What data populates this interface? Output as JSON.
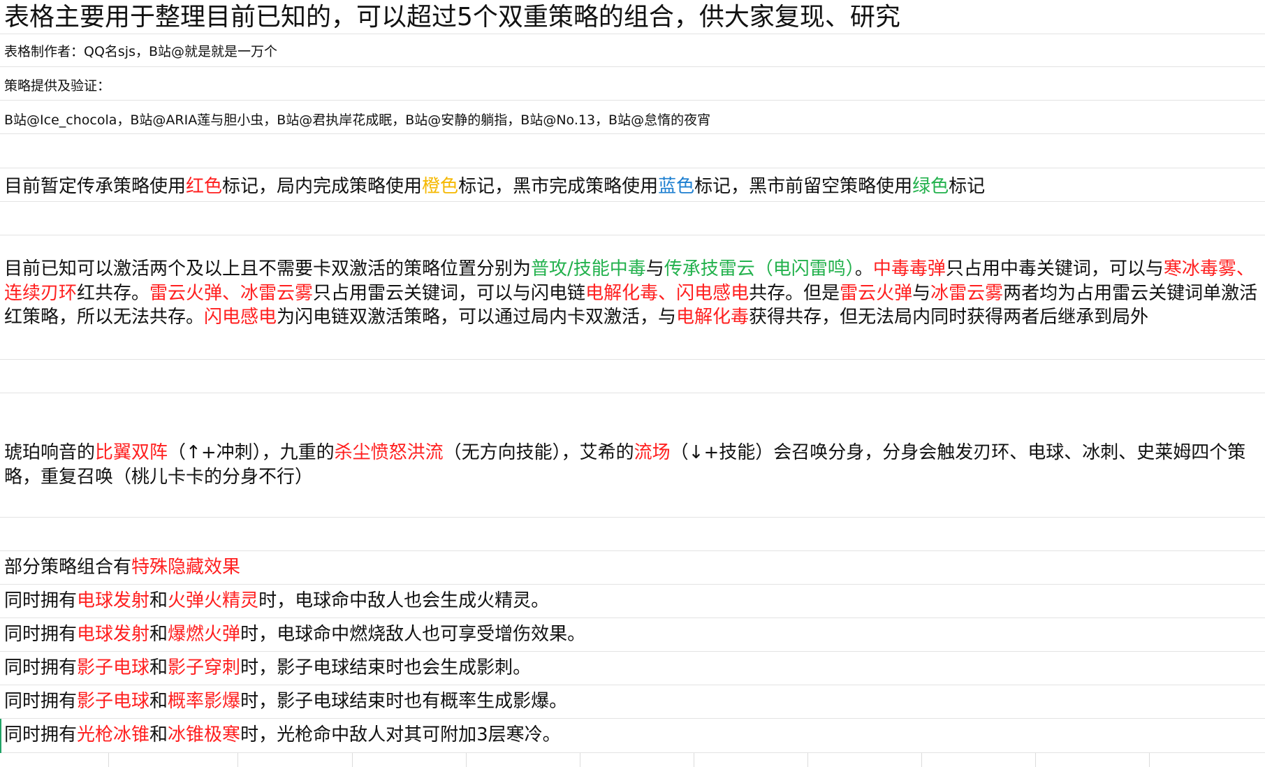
{
  "title": "表格主要用于整理目前已知的，可以超过5个双重策略的组合，供大家复现、研究",
  "author": "表格制作者：QQ名sjs，B站@就是就是一万个",
  "providers_label": "策略提供及验证：",
  "providers": "B站@Ice_chocola，B站@ARIA莲与胆小虫，B站@君执岸花成眠，B站@安静的躺指，B站@No.13，B站@怠惰的夜宵",
  "legend": {
    "p1": "目前暂定传承策略使用",
    "red": "红色",
    "p2": "标记，局内完成策略使用",
    "orange": "橙色",
    "p3": "标记，黑市完成策略使用",
    "blue": "蓝色",
    "p4": "标记，黑市前留空策略使用",
    "green": "绿色",
    "p5": "标记"
  },
  "para1": {
    "a": "目前已知可以激活两个及以上且不需要卡双激活的策略位置分别为",
    "b": "普攻/技能中毒",
    "c": "与",
    "d": "传承技雷云（电闪雷鸣）",
    "e": "。",
    "f": "中毒毒弹",
    "g": "只占用中毒关键词，可以与",
    "h": "寒冰毒雾、连续刃环",
    "i": "红共存。",
    "j": "雷云火弹、冰雷云雾",
    "k": "只占用雷云关键词，可以与闪电链",
    "l": "电解化毒、闪电感电",
    "m": "共存。但是",
    "n": "雷云火弹",
    "o": "与",
    "p": "冰雷云雾",
    "q": "两者均为占用雷云关键词单激活红策略，所以无法共存。",
    "r": "闪电感电",
    "s": "为闪电链双激活策略，可以通过局内卡双激活，与",
    "t": "电解化毒",
    "u": "获得共存，但无法局内同时获得两者后继承到局外"
  },
  "para2": {
    "a": "琥珀响音的",
    "b": "比翼双阵",
    "c": "（↑+冲刺），九重的",
    "d": "杀尘愤怒洪流",
    "e": "（无方向技能），艾希的",
    "f": "流场",
    "g": "（↓+技能）会召唤分身，分身会触发刃环、电球、冰刺、史莱姆四个策略，重复召唤（桃儿卡卡的分身不行）"
  },
  "hidden": {
    "a": "部分策略组合有",
    "b": "特殊隐藏效果"
  },
  "combos": [
    {
      "a": "同时拥有",
      "b": "电球发射",
      "c": "和",
      "d": "火弹火精灵",
      "e": "时，电球命中敌人也会生成火精灵。"
    },
    {
      "a": "同时拥有",
      "b": "电球发射",
      "c": "和",
      "d": "爆燃火弹",
      "e": "时，电球命中燃烧敌人也可享受增伤效果。"
    },
    {
      "a": "同时拥有",
      "b": "影子电球",
      "c": "和",
      "d": "影子穿刺",
      "e": "时，影子电球结束时也会生成影刺。"
    },
    {
      "a": "同时拥有",
      "b": "影子电球",
      "c": "和",
      "d": "概率影爆",
      "e": "时，影子电球结束时也有概率生成影爆。"
    },
    {
      "a": "同时拥有",
      "b": "光枪冰锥",
      "c": "和",
      "d": "冰锥极寒",
      "e": "时，光枪命中敌人对其可附加3层寒冷。"
    }
  ],
  "colors": {
    "red": "#ff1f1f",
    "orange": "#f5b800",
    "blue": "#1e7fd0",
    "green": "#22b14c",
    "gridline": "#e3e3e3",
    "selection_marker": "#21a366"
  }
}
